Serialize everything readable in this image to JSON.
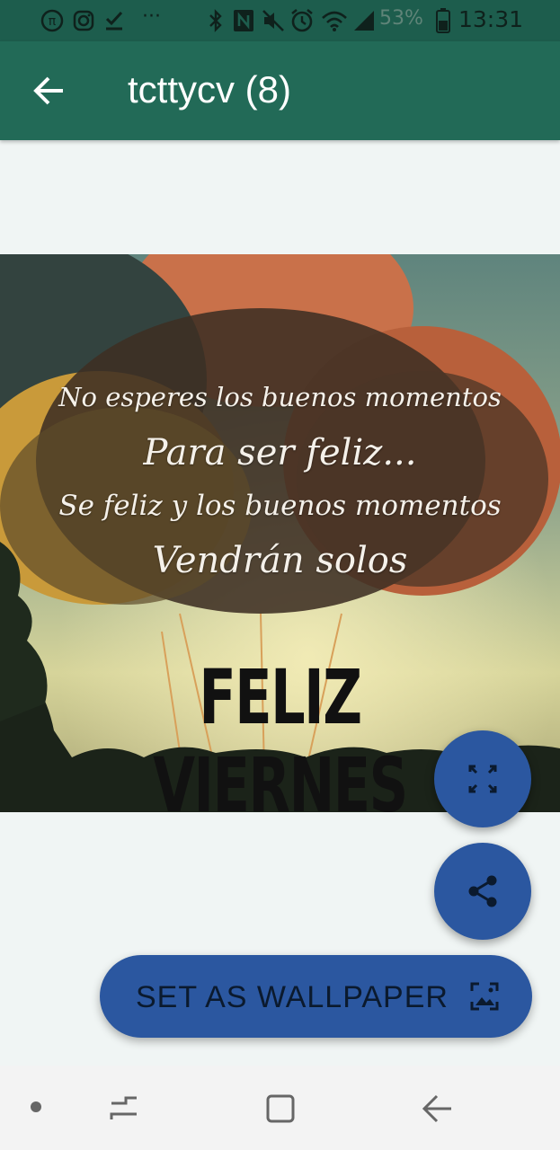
{
  "status_bar": {
    "battery": "53%",
    "time": "13:31",
    "more_indicator": "···",
    "icons": [
      "pi-icon",
      "instagram-icon",
      "download-done-icon",
      "bluetooth-icon",
      "nfc-icon",
      "mute-icon",
      "alarm-icon",
      "wifi-icon",
      "signal-icon",
      "battery-icon"
    ]
  },
  "app_bar": {
    "title": "tcttycv (8)",
    "back_icon": "arrow-left-icon"
  },
  "image": {
    "line1": "No esperes los buenos momentos",
    "line2": "Para ser feliz...",
    "line3": "Se feliz y los buenos momentos",
    "line4": "Vendrán solos",
    "headline": "FELIZ VIERNES"
  },
  "fabs": {
    "fullscreen_icon": "fullscreen-icon",
    "share_icon": "share-icon"
  },
  "wallpaper_button": {
    "label": "SET AS WALLPAPER",
    "icon": "wallpaper-icon"
  },
  "nav_bar": {
    "icons": [
      "dot-icon",
      "recents-icon",
      "home-icon",
      "back-icon"
    ]
  },
  "colors": {
    "status_bar": "#1d5d4d",
    "app_bar": "#226a57",
    "fab": "#2b57a0",
    "background": "#f0f5f4"
  }
}
